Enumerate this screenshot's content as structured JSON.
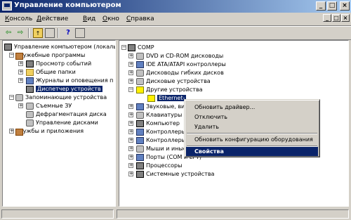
{
  "window": {
    "title": "Управление компьютером",
    "controls": [
      "_",
      "□",
      "×"
    ]
  },
  "menu": [
    "Консоль",
    "Действие",
    "Вид",
    "Окно",
    "Справка"
  ],
  "left_tree": [
    "Управление компьютером (локаль",
    "Служебные программы",
    "Просмотр событий",
    "Общие папки",
    "Журналы и оповещения п",
    "Диспетчер устройств",
    "Запоминающие устройства",
    "Съемные ЗУ",
    "Дефрагментация диска",
    "Управление дисками",
    "Службы и приложения"
  ],
  "right_tree": [
    "COMP",
    "DVD и CD-ROM дисководы",
    "IDE ATA/ATAPI контроллеры",
    "Дисководы гибких дисков",
    "Дисковые устройства",
    "Другие устройства",
    "Ethernet-",
    "Звуковые, ви",
    "Клавиатуры",
    "Компьютер",
    "Контроллеры",
    "Контроллеры",
    "Мыши и иные указывающие устройства",
    "Порты (COM и LPT)",
    "Процессоры",
    "Системные устройства"
  ],
  "context_menu": {
    "update_driver": "Обновить драйвер...",
    "disable": "Отключить",
    "delete": "Удалить",
    "scan": "Обновить конфигурацию оборудования",
    "properties": "Свойства"
  },
  "colors": {
    "selection": "#0a246a",
    "chrome": "#d4d0c8"
  }
}
